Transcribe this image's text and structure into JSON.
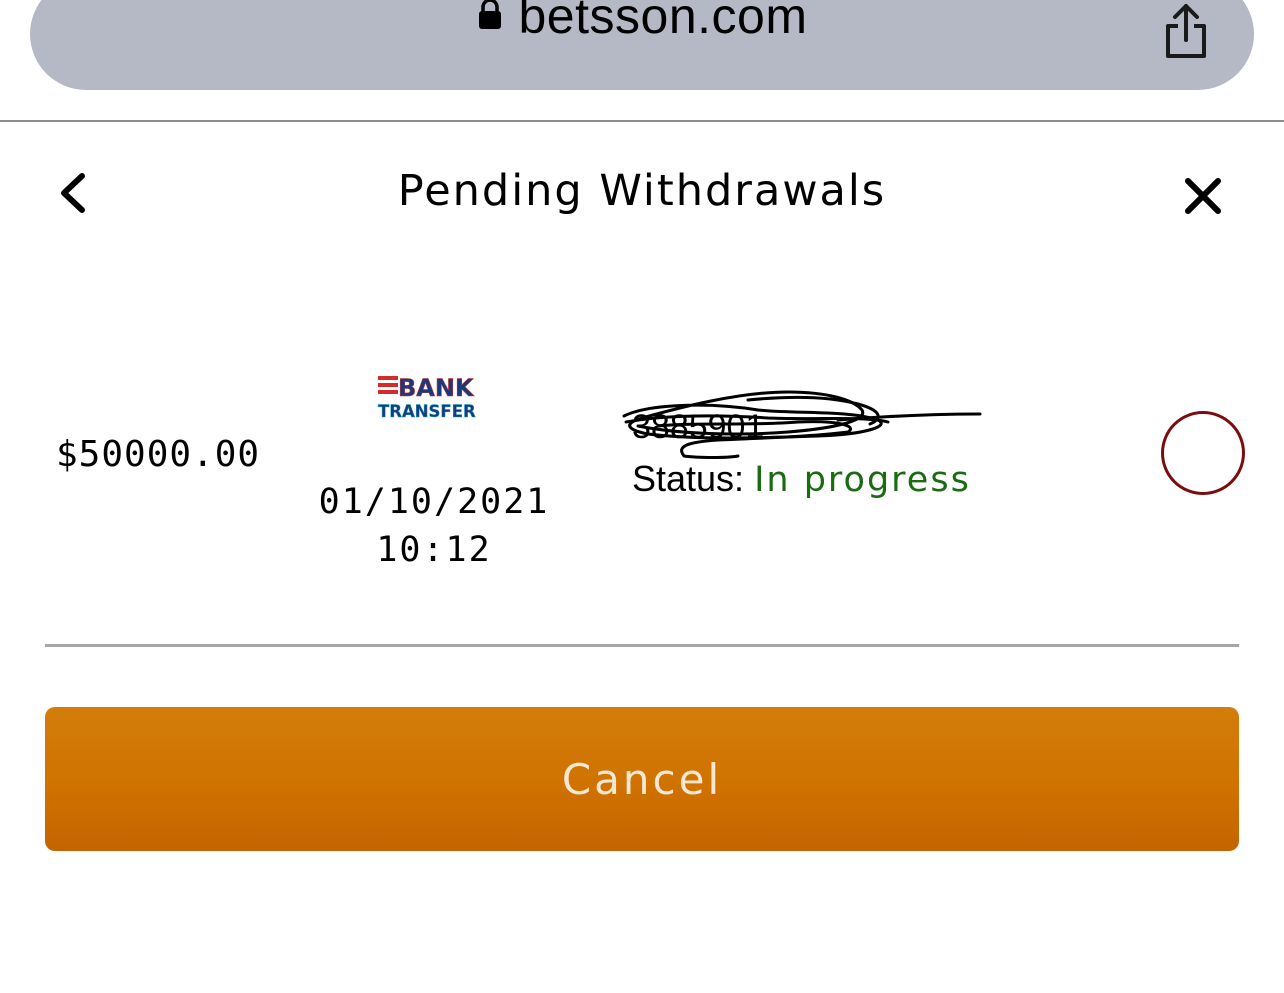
{
  "browser": {
    "url": "betsson.com",
    "lock_icon": "lock-icon",
    "share_icon": "share-icon"
  },
  "header": {
    "title": "Pending Withdrawals",
    "back_icon": "chevron-left-icon",
    "close_icon": "close-icon"
  },
  "withdrawals": [
    {
      "amount": "$50000.00",
      "method_logo": {
        "line1": "BANK",
        "line2": "TRANSFER"
      },
      "date": "01/10/2021",
      "time": "10:12",
      "reference": "3885901",
      "status_label": "Status:",
      "status_value": "In progress",
      "selected": false
    }
  ],
  "actions": {
    "cancel_label": "Cancel"
  },
  "colors": {
    "url_bar": "#b5b8c5",
    "status_green": "#1a6b12",
    "cancel_button": "#cf7200",
    "radio_border": "#7a0d0d",
    "logo_red": "#d42b2b",
    "logo_blue": "#173a7a"
  }
}
